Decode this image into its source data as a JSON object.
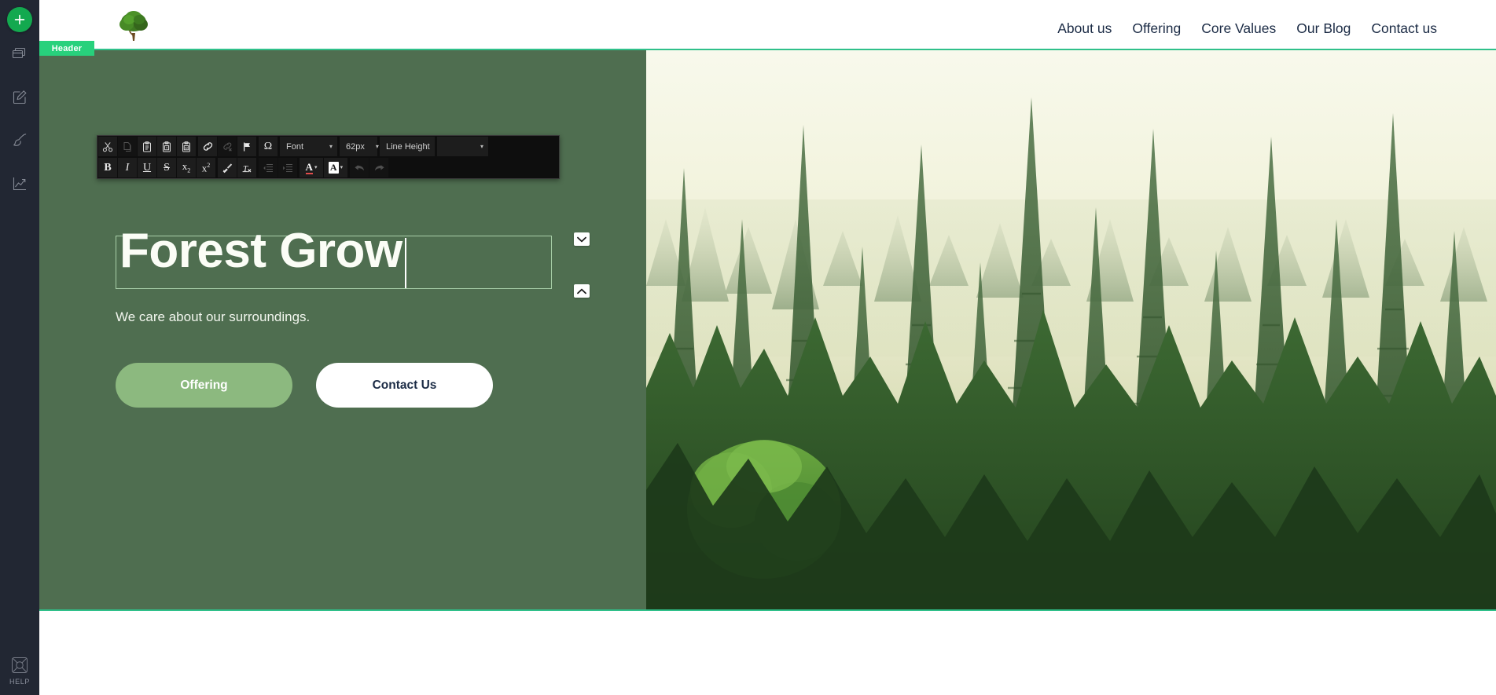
{
  "sidebar": {
    "add_button": {
      "icon": "plus-icon",
      "label": ""
    },
    "items": [
      {
        "icon": "pages-icon",
        "name": "sidebar-item-pages"
      },
      {
        "icon": "edit-icon",
        "name": "sidebar-item-edit"
      },
      {
        "icon": "brush-icon",
        "name": "sidebar-item-design"
      },
      {
        "icon": "chart-icon",
        "name": "sidebar-item-analytics"
      }
    ],
    "help": {
      "icon": "lifebuoy-icon",
      "label": "HELP"
    }
  },
  "site": {
    "logo_alt": "tree-logo",
    "nav": [
      {
        "label": "About us"
      },
      {
        "label": "Offering"
      },
      {
        "label": "Core Values"
      },
      {
        "label": "Our Blog"
      },
      {
        "label": "Contact us"
      }
    ]
  },
  "section": {
    "badge_label": "Header"
  },
  "hero": {
    "headline": "Forest Grow",
    "subtitle": "We care about our surroundings.",
    "buttons": [
      {
        "label": "Offering",
        "style": "primary"
      },
      {
        "label": "Contact Us",
        "style": "secondary"
      }
    ],
    "panel_color": "#4f6e50",
    "primary_button_color": "#8cb97f",
    "selection_border_color": "#2fc08a",
    "image_alt": "misty-pine-forest"
  },
  "editor_toolbar": {
    "row1": [
      {
        "name": "cut-icon",
        "title": "Cut",
        "enabled": true
      },
      {
        "name": "copy-icon",
        "title": "Copy",
        "enabled": false
      },
      {
        "name": "paste-icon",
        "title": "Paste",
        "enabled": true
      },
      {
        "name": "paste-as-text-icon",
        "title": "Paste as plain text",
        "enabled": true
      },
      {
        "name": "paste-from-word-icon",
        "title": "Paste from Word",
        "enabled": true
      },
      {
        "name": "link-icon",
        "title": "Link",
        "enabled": true
      },
      {
        "name": "unlink-icon",
        "title": "Unlink",
        "enabled": false
      },
      {
        "name": "anchor-flag-icon",
        "title": "Anchor",
        "enabled": true
      },
      {
        "name": "special-char-icon",
        "title": "Insert special character",
        "enabled": true
      }
    ],
    "row2": [
      {
        "name": "bold-icon",
        "title": "Bold",
        "enabled": true
      },
      {
        "name": "italic-icon",
        "title": "Italic",
        "enabled": true
      },
      {
        "name": "underline-icon",
        "title": "Underline",
        "enabled": true
      },
      {
        "name": "strikethrough-icon",
        "title": "Strikethrough",
        "enabled": true
      },
      {
        "name": "subscript-icon",
        "title": "Subscript",
        "enabled": true
      },
      {
        "name": "superscript-icon",
        "title": "Superscript",
        "enabled": true
      },
      {
        "name": "copy-formatting-icon",
        "title": "Copy formatting",
        "enabled": true
      },
      {
        "name": "remove-format-icon",
        "title": "Remove format",
        "enabled": true
      },
      {
        "name": "outdent-icon",
        "title": "Decrease indent",
        "enabled": false
      },
      {
        "name": "indent-icon",
        "title": "Increase indent",
        "enabled": false
      }
    ],
    "font_label": "Font",
    "font_size": "62px",
    "line_height_label": "Line Height",
    "style_label": "",
    "text_color_label": "A",
    "bg_color_label": "A",
    "undo_title": "Undo",
    "redo_title": "Redo",
    "dropdown_arrow": "▾"
  }
}
